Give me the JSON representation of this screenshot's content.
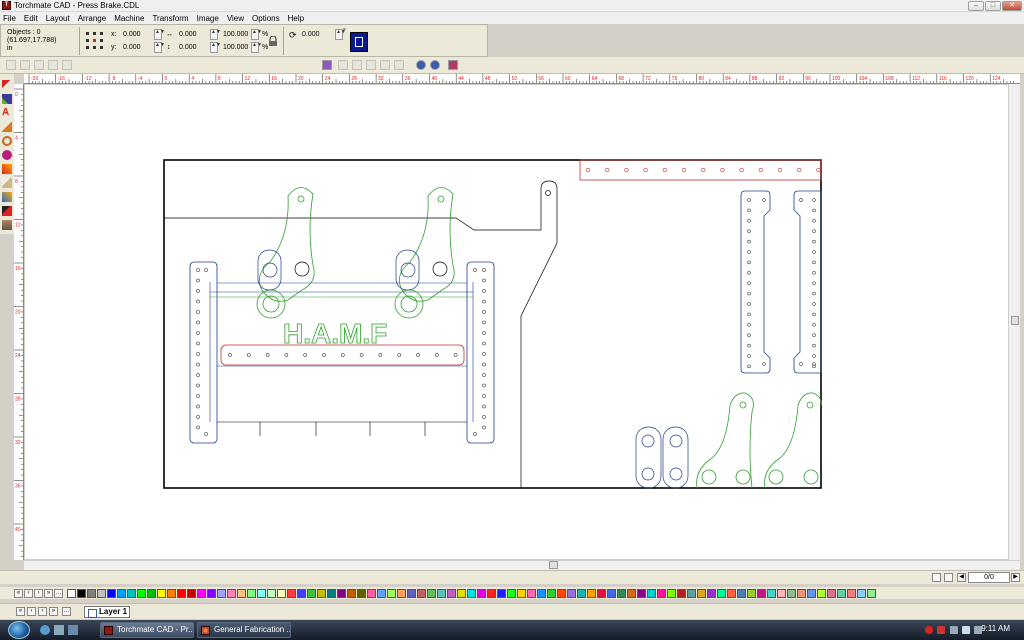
{
  "window": {
    "title": "Torchmate CAD - Press Brake.CDL"
  },
  "menu": [
    "File",
    "Edit",
    "Layout",
    "Arrange",
    "Machine",
    "Transform",
    "Image",
    "View",
    "Options",
    "Help"
  ],
  "properties": {
    "objects_label": "Objects : 0",
    "cursor_coords": "(61.697,17.788)",
    "units": "in",
    "x_label": "x:",
    "x_value": "0.000",
    "y_label": "y:",
    "y_value": "0.000",
    "width_value": "0.000",
    "height_value": "0.000",
    "scale_x": "100.000",
    "scale_y": "100.000",
    "percent": "%",
    "rotation_value": "0.000",
    "degree": "°"
  },
  "ruler": {
    "h_labels": [
      "-20",
      "-16",
      "-12",
      "-8",
      "-4",
      "0",
      "4",
      "8",
      "12",
      "16",
      "20",
      "24",
      "28",
      "32",
      "36",
      "40",
      "44",
      "48",
      "52",
      "56",
      "60",
      "64",
      "68",
      "72",
      "76",
      "80",
      "84",
      "88",
      "92",
      "96",
      "100",
      "104",
      "108",
      "112",
      "116",
      "120",
      "124"
    ],
    "v_labels": [
      "0",
      "4",
      "8",
      "12",
      "16",
      "20",
      "24",
      "28",
      "32",
      "36",
      "40"
    ]
  },
  "canvas": {
    "logo_text": "H.A.M.F"
  },
  "pagebar": {
    "page_count": "0/0"
  },
  "layers": {
    "active": "Layer 1"
  },
  "taskbar": {
    "items": [
      "Torchmate CAD - Pr...",
      "General Fabrication ..."
    ],
    "clock": "9:11 AM"
  },
  "colors": {
    "outline_blue": "#1f3c88",
    "outline_green": "#2ea02e",
    "outline_red": "#c0302a",
    "frame": "#000000"
  }
}
